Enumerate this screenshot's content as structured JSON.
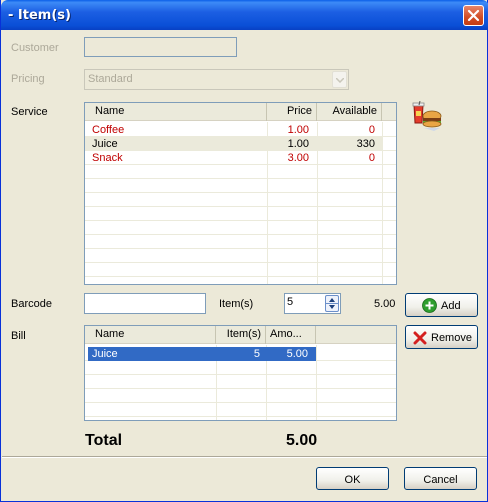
{
  "window": {
    "title": "- Item(s)"
  },
  "form": {
    "customer_label": "Customer",
    "customer_value": "",
    "pricing_label": "Pricing",
    "pricing_value": "Standard",
    "service_label": "Service",
    "barcode_label": "Barcode",
    "barcode_value": "",
    "items_label": "Item(s)",
    "items_value": "5",
    "line_amount": "5.00",
    "bill_label": "Bill"
  },
  "service_grid": {
    "columns": [
      "Name",
      "Price",
      "Available"
    ],
    "rows": [
      {
        "name": "Coffee",
        "price": "1.00",
        "available": "0",
        "unavailable": true
      },
      {
        "name": "Juice",
        "price": "1.00",
        "available": "330",
        "unavailable": false
      },
      {
        "name": "Snack",
        "price": "3.00",
        "available": "0",
        "unavailable": true
      }
    ]
  },
  "bill_grid": {
    "columns": [
      "Name",
      "Item(s)",
      "Amo..."
    ],
    "rows": [
      {
        "name": "Juice",
        "items": "5",
        "amount": "5.00",
        "selected": true
      }
    ]
  },
  "buttons": {
    "add": "Add",
    "remove": "Remove",
    "ok": "OK",
    "cancel": "Cancel"
  },
  "totals": {
    "label": "Total",
    "value": "5.00"
  },
  "icons": {
    "service_icon": "food-drink-icon",
    "add_icon": "plus-circle-icon",
    "remove_icon": "red-x-icon",
    "close_icon": "close-icon"
  },
  "colors": {
    "titlebar": "#0a4fd6",
    "unavailable_text": "#c00000",
    "selection": "#316ac5",
    "window_bg": "#ece9d8"
  }
}
